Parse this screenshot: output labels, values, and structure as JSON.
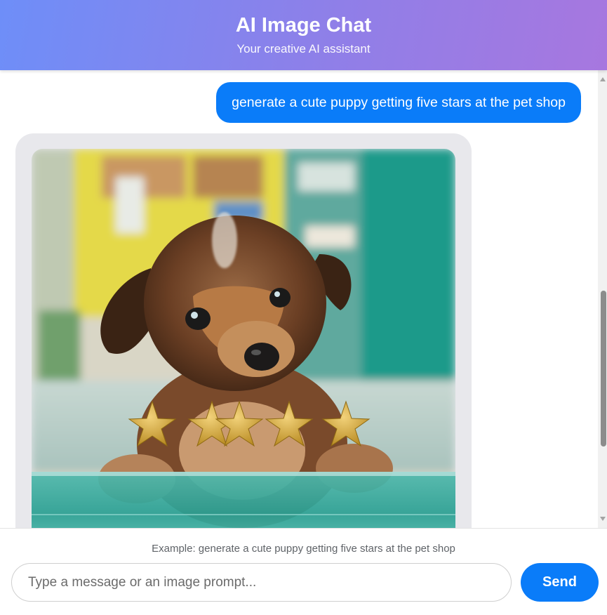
{
  "header": {
    "title": "AI Image Chat",
    "subtitle": "Your creative AI assistant"
  },
  "chat": {
    "messages": [
      {
        "role": "user",
        "text": "generate a cute puppy getting five stars at the pet shop"
      },
      {
        "role": "assistant",
        "content": "generated-image",
        "image_subject": "puppy-with-five-stars",
        "stars": 5
      }
    ]
  },
  "footer": {
    "example": "Example: generate a cute puppy getting five stars at the pet shop",
    "input": {
      "placeholder": "Type a message or an image prompt...",
      "value": ""
    },
    "send_label": "Send"
  },
  "colors": {
    "header_gradient_start": "#6e8ef8",
    "header_gradient_end": "#a777df",
    "accent_blue": "#0a7cf9",
    "ai_bubble_bg": "#e8e8ec",
    "star_gold": "#d4a93a"
  }
}
